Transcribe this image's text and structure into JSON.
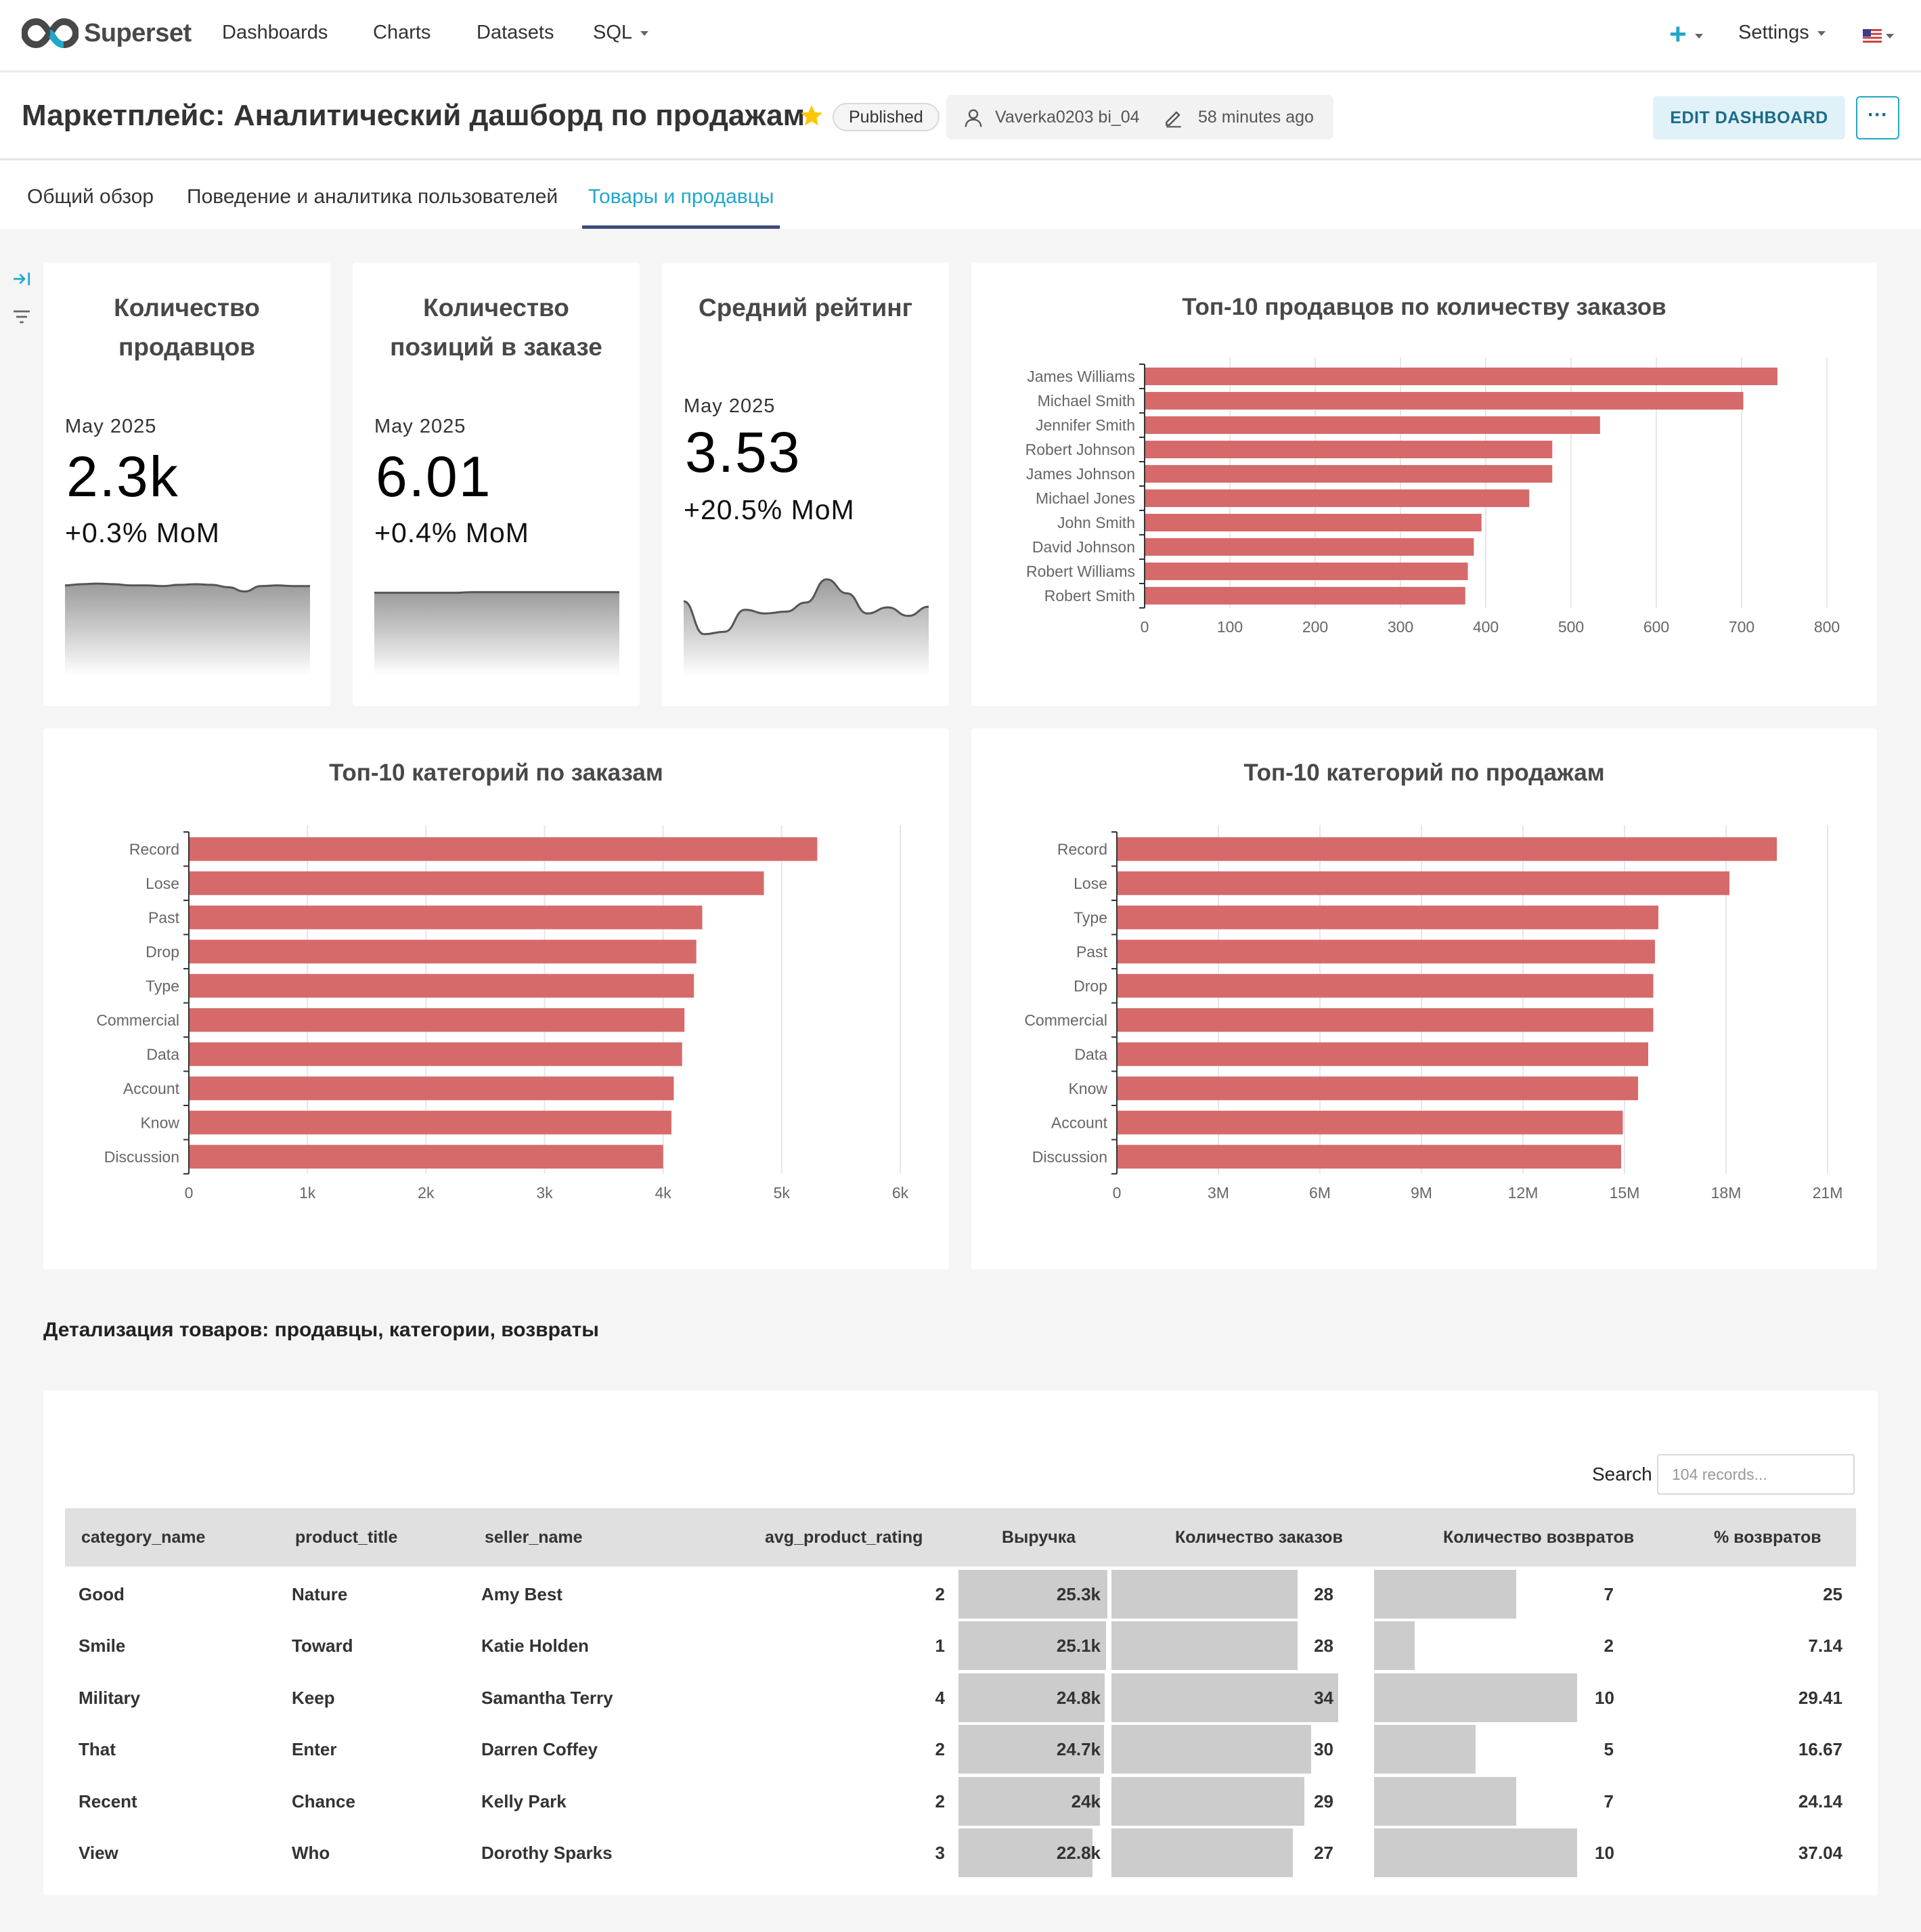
{
  "nav": {
    "brand": "Superset",
    "items": [
      {
        "label": "Dashboards",
        "has_caret": false
      },
      {
        "label": "Charts",
        "has_caret": false
      },
      {
        "label": "Datasets",
        "has_caret": false
      },
      {
        "label": "SQL",
        "has_caret": true
      }
    ],
    "settings_label": "Settings"
  },
  "header": {
    "title": "Маркетплейс: Аналитический дашборд по продажам",
    "status": "Published",
    "owner": "Vaverka0203 bi_04",
    "modified": "58 minutes ago",
    "edit_button": "EDIT DASHBOARD",
    "more_button": "···"
  },
  "tabs": [
    {
      "label": "Общий обзор",
      "active": false
    },
    {
      "label": "Поведение и аналитика пользователей",
      "active": false
    },
    {
      "label": "Товары и продавцы",
      "active": true
    }
  ],
  "kpis": [
    {
      "title_lines": [
        "Количество",
        "продавцов"
      ],
      "date": "May 2025",
      "value": "2.3k",
      "change": "+0.3% MoM",
      "trend": [
        0.88,
        0.9,
        0.91,
        0.9,
        0.88,
        0.88,
        0.87,
        0.89,
        0.9,
        0.89,
        0.85,
        0.78,
        0.87,
        0.88,
        0.87,
        0.87
      ]
    },
    {
      "title_lines": [
        "Количество",
        "позиций в заказе"
      ],
      "date": "May 2025",
      "value": "6.01",
      "change": "+0.4% MoM",
      "trend": [
        0.76,
        0.76,
        0.76,
        0.76,
        0.76,
        0.76,
        0.77,
        0.77,
        0.77,
        0.77,
        0.77,
        0.77,
        0.77,
        0.77,
        0.77,
        0.77
      ]
    },
    {
      "title_lines": [
        "Средний рейтинг"
      ],
      "date": "May 2025",
      "value": "3.53",
      "change": "+20.5% MoM",
      "trend": [
        0.62,
        0.08,
        0.12,
        0.48,
        0.42,
        0.45,
        0.6,
        0.98,
        0.75,
        0.42,
        0.52,
        0.38,
        0.53
      ]
    }
  ],
  "chart_data": [
    {
      "type": "bar",
      "orientation": "horizontal",
      "title": "Топ-10 продавцов по количеству заказов",
      "categories": [
        "James Williams",
        "Michael Smith",
        "Jennifer Smith",
        "Robert Johnson",
        "James Johnson",
        "Michael Jones",
        "John Smith",
        "David Johnson",
        "Robert Williams",
        "Robert Smith"
      ],
      "values": [
        742,
        702,
        534,
        478,
        478,
        451,
        395,
        386,
        379,
        376
      ],
      "xlim": [
        0,
        800
      ],
      "ticks": [
        "0",
        "100",
        "200",
        "300",
        "400",
        "500",
        "600",
        "700",
        "800"
      ],
      "grid": true,
      "color": "#d66a6a"
    },
    {
      "type": "bar",
      "orientation": "horizontal",
      "title": "Топ-10 категорий по заказам",
      "categories": [
        "Record",
        "Lose",
        "Past",
        "Drop",
        "Type",
        "Commercial",
        "Data",
        "Account",
        "Know",
        "Discussion"
      ],
      "values": [
        5300,
        4850,
        4330,
        4280,
        4260,
        4180,
        4160,
        4090,
        4070,
        4000
      ],
      "xlim": [
        0,
        6000
      ],
      "ticks": [
        "0",
        "1k",
        "2k",
        "3k",
        "4k",
        "5k",
        "6k"
      ],
      "grid": true,
      "color": "#d66a6a"
    },
    {
      "type": "bar",
      "orientation": "horizontal",
      "title": "Топ-10 категорий по продажам",
      "categories": [
        "Record",
        "Lose",
        "Type",
        "Past",
        "Drop",
        "Commercial",
        "Data",
        "Know",
        "Account",
        "Discussion"
      ],
      "values": [
        19500000,
        18100000,
        16000000,
        15900000,
        15850000,
        15850000,
        15700000,
        15400000,
        14950000,
        14900000
      ],
      "xlim": [
        0,
        21000000
      ],
      "ticks": [
        "0",
        "3M",
        "6M",
        "9M",
        "12M",
        "15M",
        "18M",
        "21M"
      ],
      "grid": true,
      "color": "#d66a6a"
    }
  ],
  "details": {
    "section_title": "Детализация товаров: продавцы, категории, возвраты",
    "search_label": "Search",
    "search_placeholder": "104 records...",
    "columns": [
      "category_name",
      "product_title",
      "seller_name",
      "avg_product_rating",
      "Выручка",
      "Количество заказов",
      "Количество возвратов",
      "% возвратов"
    ],
    "rows": [
      {
        "category": "Good",
        "product": "Nature",
        "seller": "Amy Best",
        "rating": "2",
        "revenue": "25.3k",
        "revenue_share": 1.0,
        "orders": "28",
        "orders_share": 0.82,
        "returns": "7",
        "returns_share": 0.7,
        "pct": "25"
      },
      {
        "category": "Smile",
        "product": "Toward",
        "seller": "Katie Holden",
        "rating": "1",
        "revenue": "25.1k",
        "revenue_share": 0.99,
        "orders": "28",
        "orders_share": 0.82,
        "returns": "2",
        "returns_share": 0.2,
        "pct": "7.14"
      },
      {
        "category": "Military",
        "product": "Keep",
        "seller": "Samantha Terry",
        "rating": "4",
        "revenue": "24.8k",
        "revenue_share": 0.98,
        "orders": "34",
        "orders_share": 1.0,
        "returns": "10",
        "returns_share": 1.0,
        "pct": "29.41"
      },
      {
        "category": "That",
        "product": "Enter",
        "seller": "Darren Coffey",
        "rating": "2",
        "revenue": "24.7k",
        "revenue_share": 0.976,
        "orders": "30",
        "orders_share": 0.88,
        "returns": "5",
        "returns_share": 0.5,
        "pct": "16.67"
      },
      {
        "category": "Recent",
        "product": "Chance",
        "seller": "Kelly Park",
        "rating": "2",
        "revenue": "24k",
        "revenue_share": 0.95,
        "orders": "29",
        "orders_share": 0.85,
        "returns": "7",
        "returns_share": 0.7,
        "pct": "24.14"
      },
      {
        "category": "View",
        "product": "Who",
        "seller": "Dorothy Sparks",
        "rating": "3",
        "revenue": "22.8k",
        "revenue_share": 0.9,
        "orders": "27",
        "orders_share": 0.8,
        "returns": "10",
        "returns_share": 1.0,
        "pct": "37.04"
      }
    ]
  },
  "colors": {
    "accent": "#20a7c9",
    "bar": "#d66a6a",
    "table_bar": "#cccccc"
  }
}
